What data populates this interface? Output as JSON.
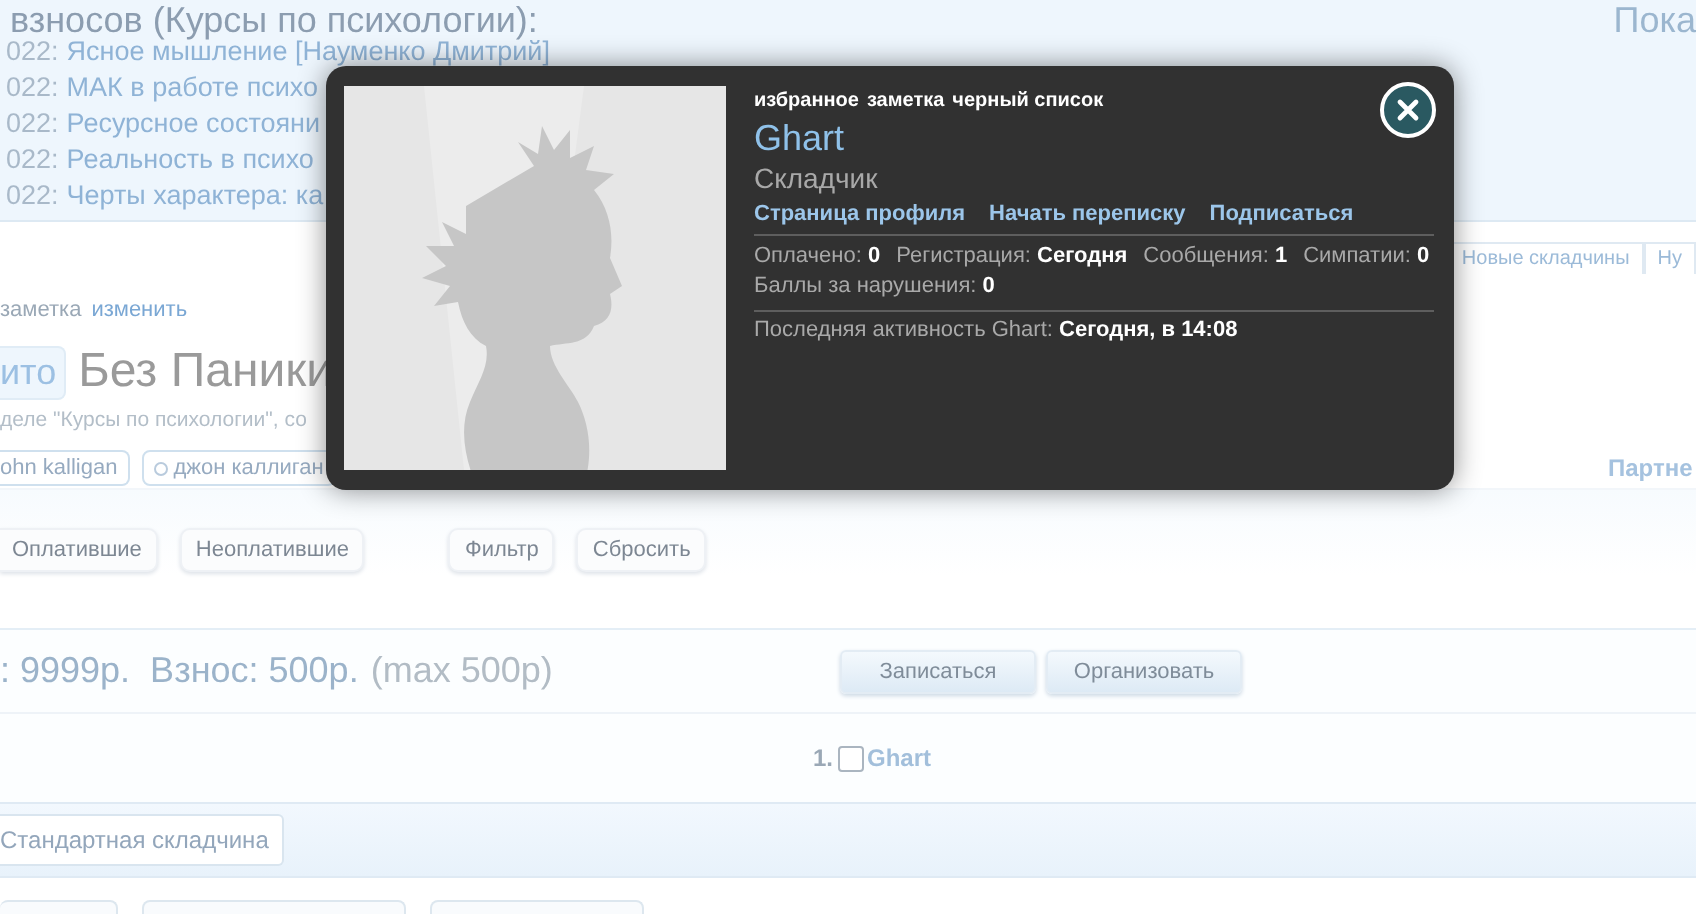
{
  "page": {
    "heading": "взносов (Курсы по психологии):",
    "top_right": "Пока",
    "list": [
      {
        "prefix": "022:",
        "title": "Ясное мышление [Науменко Дмитрий]"
      },
      {
        "prefix": "022:",
        "title": "МАК в работе психо"
      },
      {
        "prefix": "022:",
        "title": "Ресурсное состояни"
      },
      {
        "prefix": "022:",
        "title": "Реальность в психо"
      },
      {
        "prefix": "022:",
        "title": "Черты характера: ка"
      }
    ],
    "tabs": [
      {
        "label": "Новые складчины",
        "selected": false
      },
      {
        "label": "Ну",
        "selected": false
      }
    ]
  },
  "thread": {
    "note": "заметка",
    "edit": "изменить",
    "prefix_badge": "ито",
    "title": "Без Паники",
    "subtitle": "деле \"Курсы по психологии\", со",
    "tags": [
      "ohn kalligan",
      "джон каллиган"
    ],
    "partner": "Партне"
  },
  "filter_buttons": [
    "Оплатившие",
    "Неоплатившие"
  ],
  "action_buttons": [
    "Фильтр",
    "Сбросить"
  ],
  "price": {
    "main": ": 9999р.  Взнос: 500р.",
    "max": "(max 500р)"
  },
  "join_buttons": [
    "Записаться",
    "Организовать"
  ],
  "participants": [
    {
      "number": "1.",
      "name": "Ghart",
      "checked": false
    }
  ],
  "type_tag": "Стандартная складчина",
  "popup": {
    "actions": [
      "избранное",
      "заметка",
      "черный список"
    ],
    "name": "Ghart",
    "role": "Складчик",
    "links": [
      "Страница профиля",
      "Начать переписку",
      "Подписаться"
    ],
    "stats": [
      "Оплачено: **0**",
      "Регистрация: **Сегодня**",
      "Сообщения: **1**",
      "Симпатии: **0**",
      "Баллы за нарушения: **0**"
    ],
    "last_activity": "Последняя активность Ghart: **Сегодня, в 14:08**"
  }
}
